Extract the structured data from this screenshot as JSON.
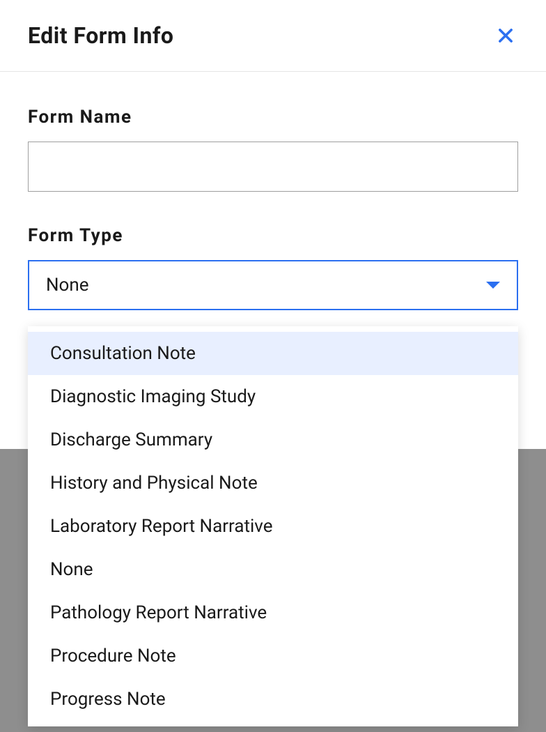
{
  "modal": {
    "title": "Edit Form Info",
    "fields": {
      "formName": {
        "label": "Form Name",
        "value": ""
      },
      "formType": {
        "label": "Form Type",
        "selected": "None",
        "options": [
          "Consultation Note",
          "Diagnostic Imaging Study",
          "Discharge Summary",
          "History and Physical Note",
          "Laboratory Report Narrative",
          "None",
          "Pathology Report Narrative",
          "Procedure Note",
          "Progress Note"
        ],
        "highlightedIndex": 0
      }
    }
  },
  "colors": {
    "accent": "#2b6ff0",
    "closeIcon": "#2b6ff0",
    "highlight": "#e8efff",
    "backdrop": "#8e8e8e"
  }
}
